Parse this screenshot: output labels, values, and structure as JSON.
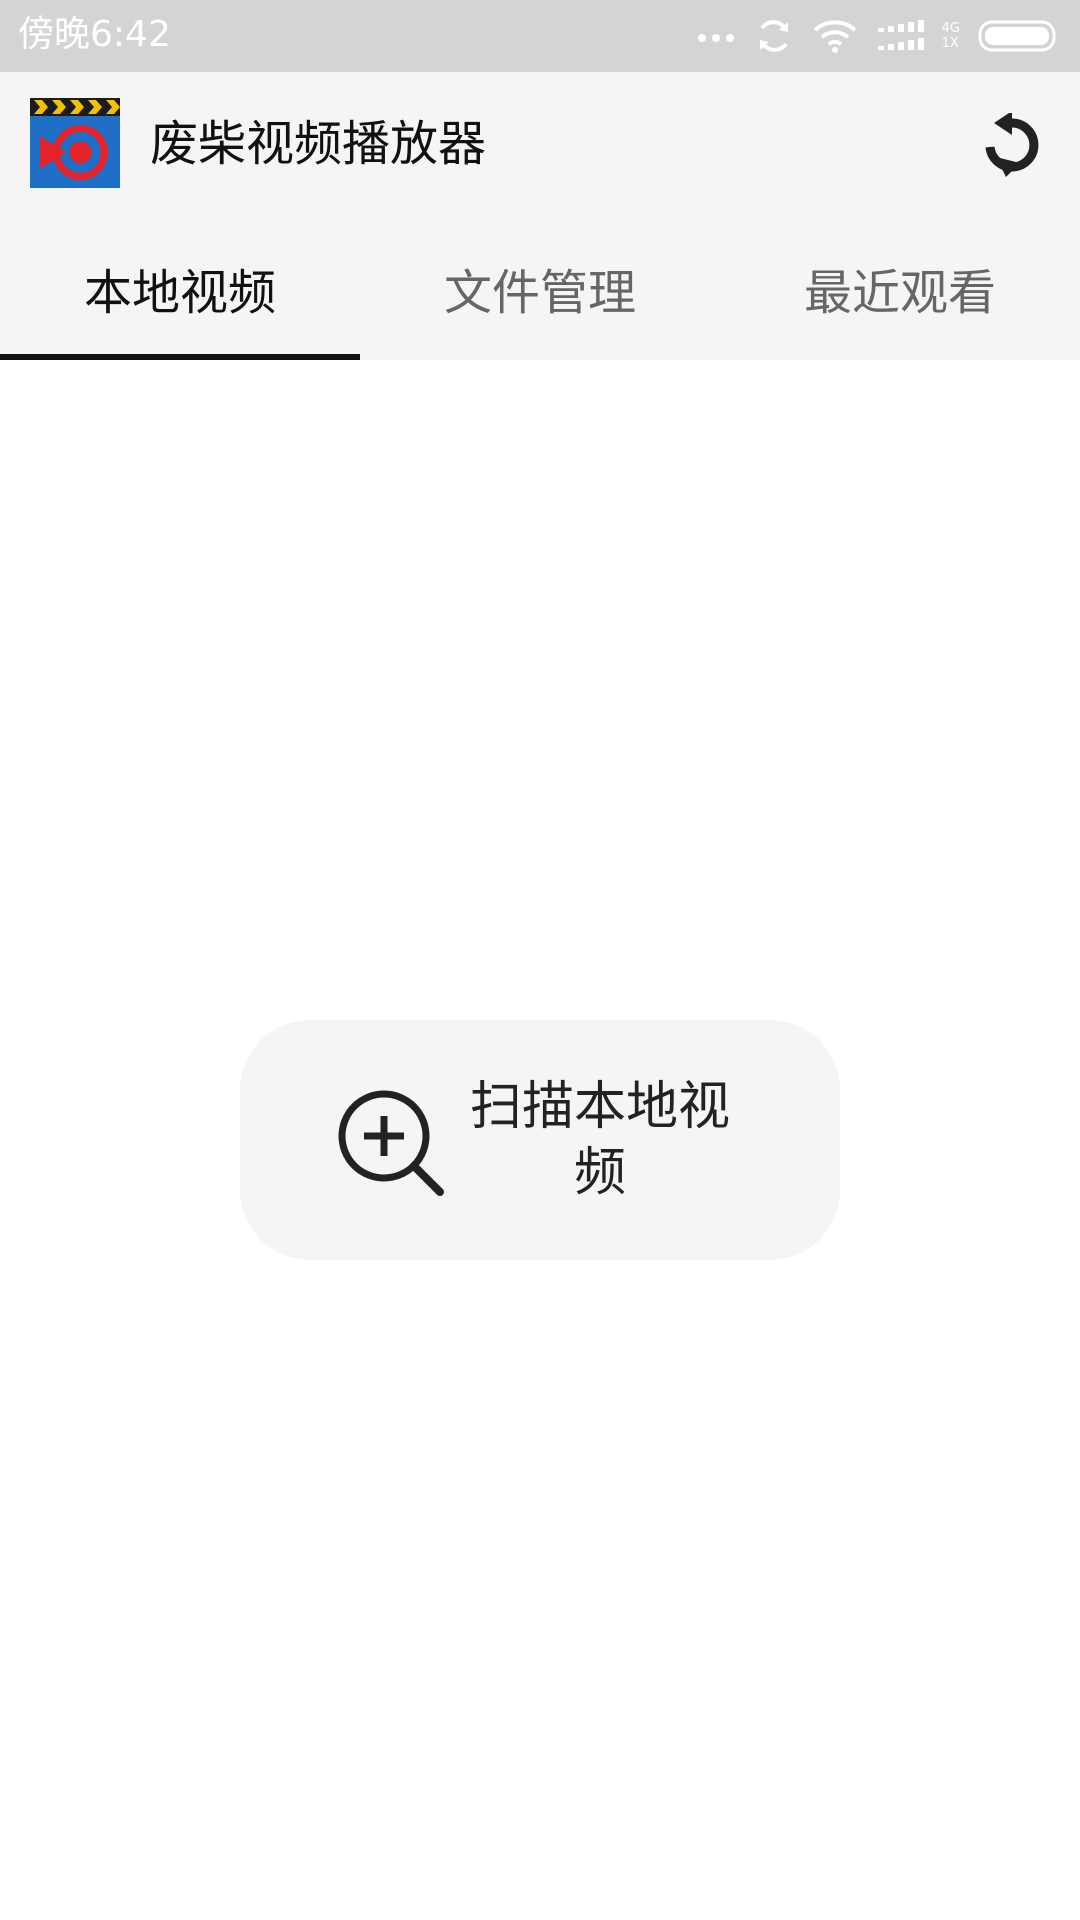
{
  "status_bar": {
    "time": "傍晚6:42",
    "network_top": "4G",
    "network_bottom": "1X",
    "icons": [
      "more-dots-icon",
      "sync-icon",
      "wifi-icon",
      "signal-icon",
      "battery-icon"
    ]
  },
  "app_bar": {
    "title": "废柴视频播放器",
    "logo_icon": "clapperboard-video-logo",
    "refresh_icon": "refresh-icon"
  },
  "tabs": [
    {
      "label": "本地视频",
      "active": true
    },
    {
      "label": "文件管理",
      "active": false
    },
    {
      "label": "最近观看",
      "active": false
    }
  ],
  "main": {
    "scan_button_label": "扫描本地视频",
    "scan_icon": "zoom-in-search-icon"
  },
  "colors": {
    "status_bar_bg": "#d4d4d4",
    "app_bar_bg": "#f6f4f5",
    "tab_indicator": "#111111",
    "logo_blue": "#1f6fc6",
    "logo_red": "#e5232b",
    "logo_yellow": "#f2c100"
  }
}
